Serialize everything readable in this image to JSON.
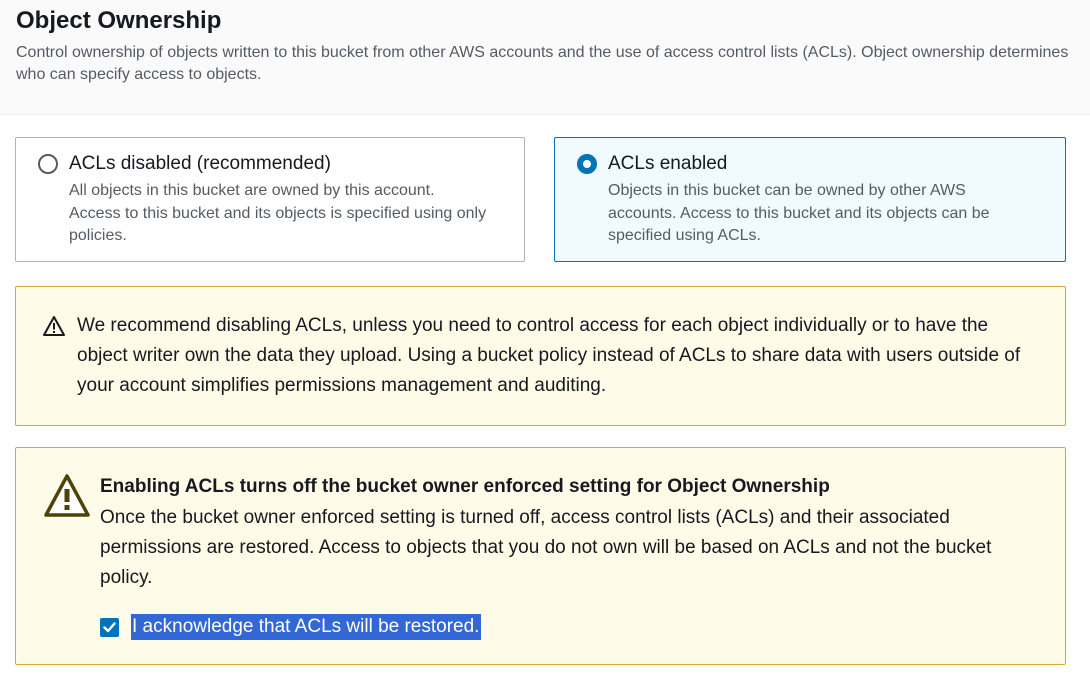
{
  "header": {
    "title": "Object Ownership",
    "description": "Control ownership of objects written to this bucket from other AWS accounts and the use of access control lists (ACLs). Object ownership determines who can specify access to objects."
  },
  "options": [
    {
      "label": "ACLs disabled (recommended)",
      "description": "All objects in this bucket are owned by this account. Access to this bucket and its objects is specified using only policies.",
      "selected": false
    },
    {
      "label": "ACLs enabled",
      "description": "Objects in this bucket can be owned by other AWS accounts. Access to this bucket and its objects can be specified using ACLs.",
      "selected": true
    }
  ],
  "info_alert": {
    "icon": "warning-icon",
    "text": "We recommend disabling ACLs, unless you need to control access for each object individually or to have the object writer own the data they upload. Using a bucket policy instead of ACLs to share data with users outside of your account simplifies permissions management and auditing."
  },
  "warning_alert": {
    "icon": "warning-icon",
    "heading": "Enabling ACLs turns off the bucket owner enforced setting for Object Ownership",
    "body": "Once the bucket owner enforced setting is turned off, access control lists (ACLs) and their associated permissions are restored. Access to objects that you do not own will be based on ACLs and not the bucket policy.",
    "acknowledge_label": "I acknowledge that ACLs will be restored.",
    "acknowledge_checked": true
  },
  "colors": {
    "accent": "#0073bb",
    "warning_border": "#d8a93a",
    "warning_bg": "#fffbe9",
    "selected_bg": "#f1faff"
  }
}
